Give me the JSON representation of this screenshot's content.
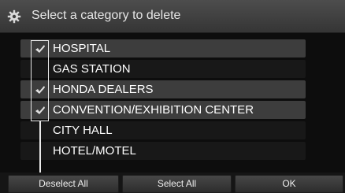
{
  "header": {
    "title": "Select a category to delete",
    "icon": "gear-icon"
  },
  "categories": [
    {
      "label": "HOSPITAL",
      "checked": true,
      "shaded": true
    },
    {
      "label": "GAS STATION",
      "checked": false,
      "shaded": false
    },
    {
      "label": "HONDA DEALERS",
      "checked": true,
      "shaded": true
    },
    {
      "label": "CONVENTION/EXHIBITION CENTER",
      "checked": true,
      "shaded": true
    },
    {
      "label": "CITY HALL",
      "checked": false,
      "shaded": false
    },
    {
      "label": "HOTEL/MOTEL",
      "checked": false,
      "shaded": false
    }
  ],
  "buttons": {
    "deselect_all": "Deselect All",
    "select_all": "Select All",
    "ok": "OK"
  },
  "colors": {
    "background": "#0d0d0d",
    "header": "#404040",
    "row_shaded": "#3d3d3d",
    "text": "#ffffff"
  }
}
